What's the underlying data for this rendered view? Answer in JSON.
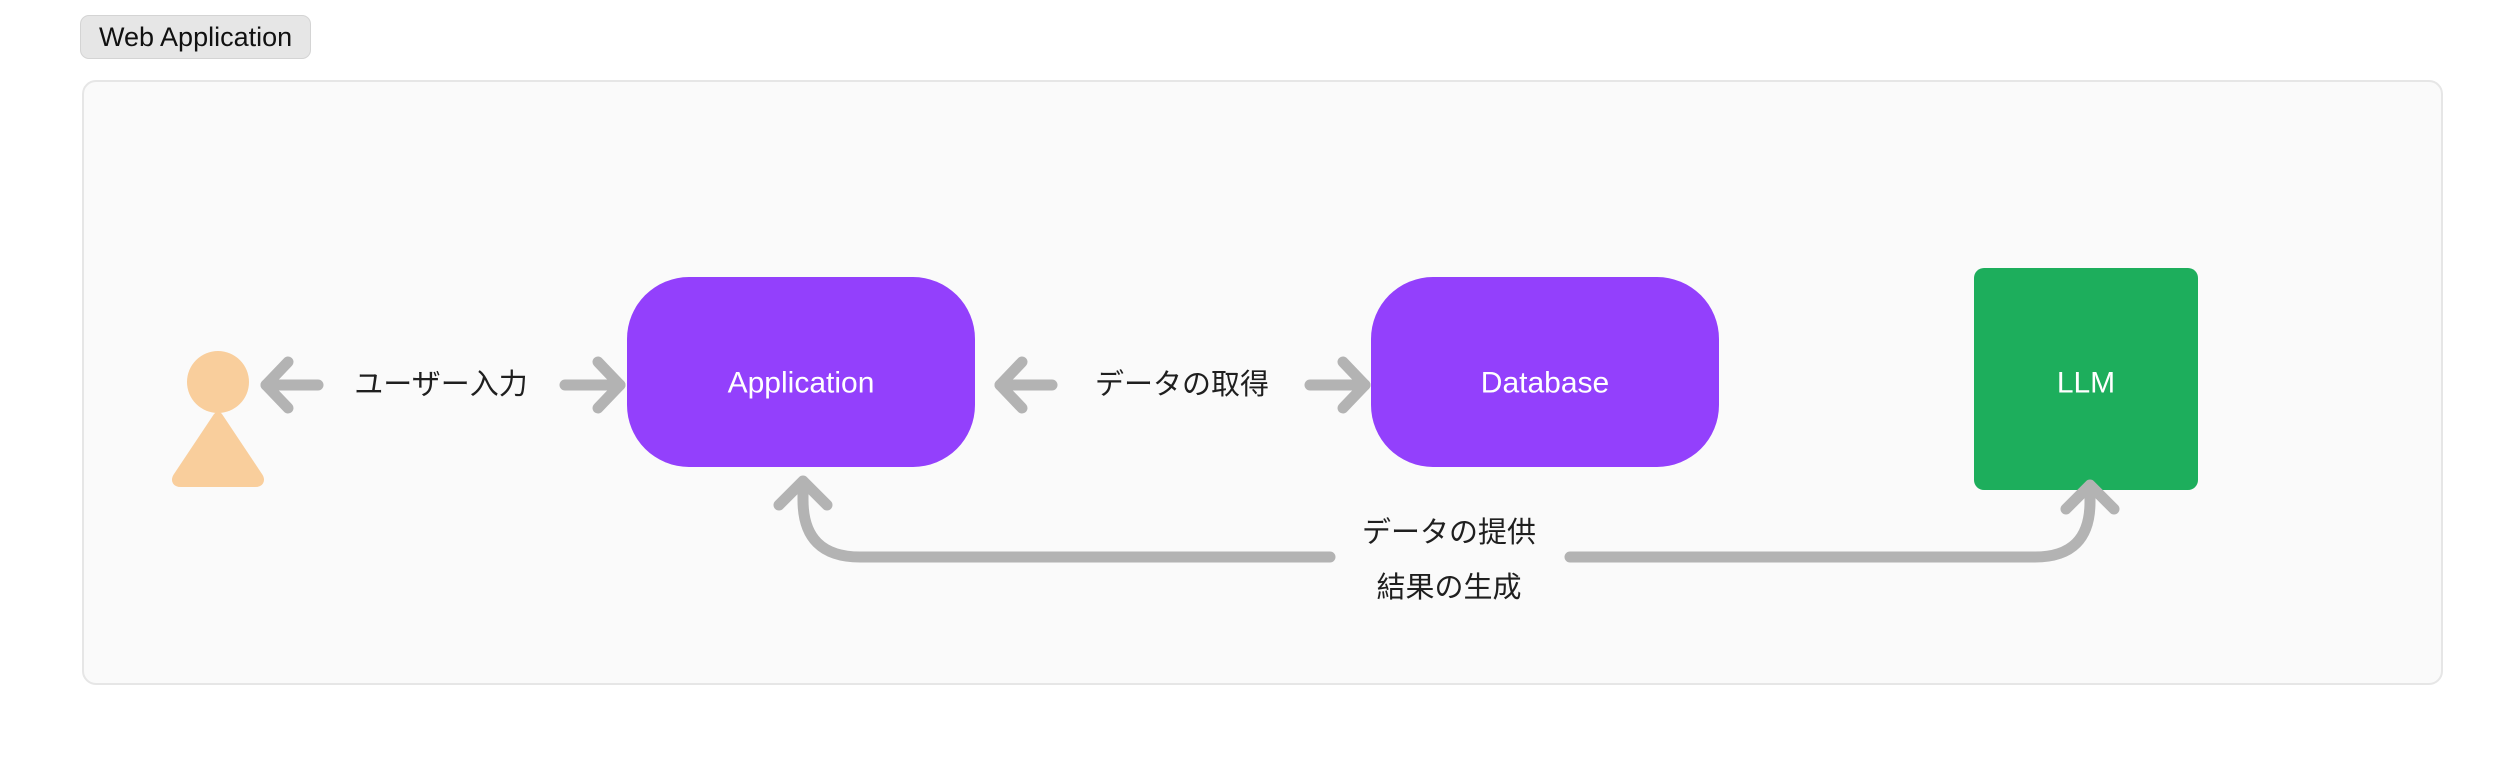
{
  "group": {
    "label": "Web Application",
    "border_color": "#e6e6e6",
    "background_color": "#fafafa",
    "chip_background": "#e6e6e6"
  },
  "nodes": [
    {
      "id": "user",
      "label": "",
      "shape": "person",
      "color": "#f9ce9c"
    },
    {
      "id": "application",
      "label": "Application",
      "shape": "stadium",
      "color": "#9340fc",
      "text_color": "#ffffff"
    },
    {
      "id": "database",
      "label": "Database",
      "shape": "stadium",
      "color": "#9340fc",
      "text_color": "#ffffff"
    },
    {
      "id": "llm",
      "label": "LLM",
      "shape": "rectangle",
      "color": "#1dae5c",
      "text_color": "#ffffff"
    }
  ],
  "edges": [
    {
      "id": "user-application",
      "label": "ユーザー入力",
      "from": "user",
      "to": "application",
      "direction": "bidirectional",
      "color": "#b3b3b3"
    },
    {
      "id": "application-database",
      "label": "データの取得",
      "from": "application",
      "to": "database",
      "direction": "bidirectional",
      "color": "#b3b3b3"
    },
    {
      "id": "llm-application",
      "label": "データの提供",
      "from": "llm",
      "to": "application",
      "direction": "unidirectional",
      "color": "#b3b3b3"
    },
    {
      "id": "application-llm",
      "label": "結果の生成",
      "from": "application",
      "to": "llm",
      "direction": "unidirectional",
      "color": "#b3b3b3"
    }
  ],
  "arrow_glyphs": {
    "left": "←",
    "right": "→",
    "up": "↑"
  }
}
